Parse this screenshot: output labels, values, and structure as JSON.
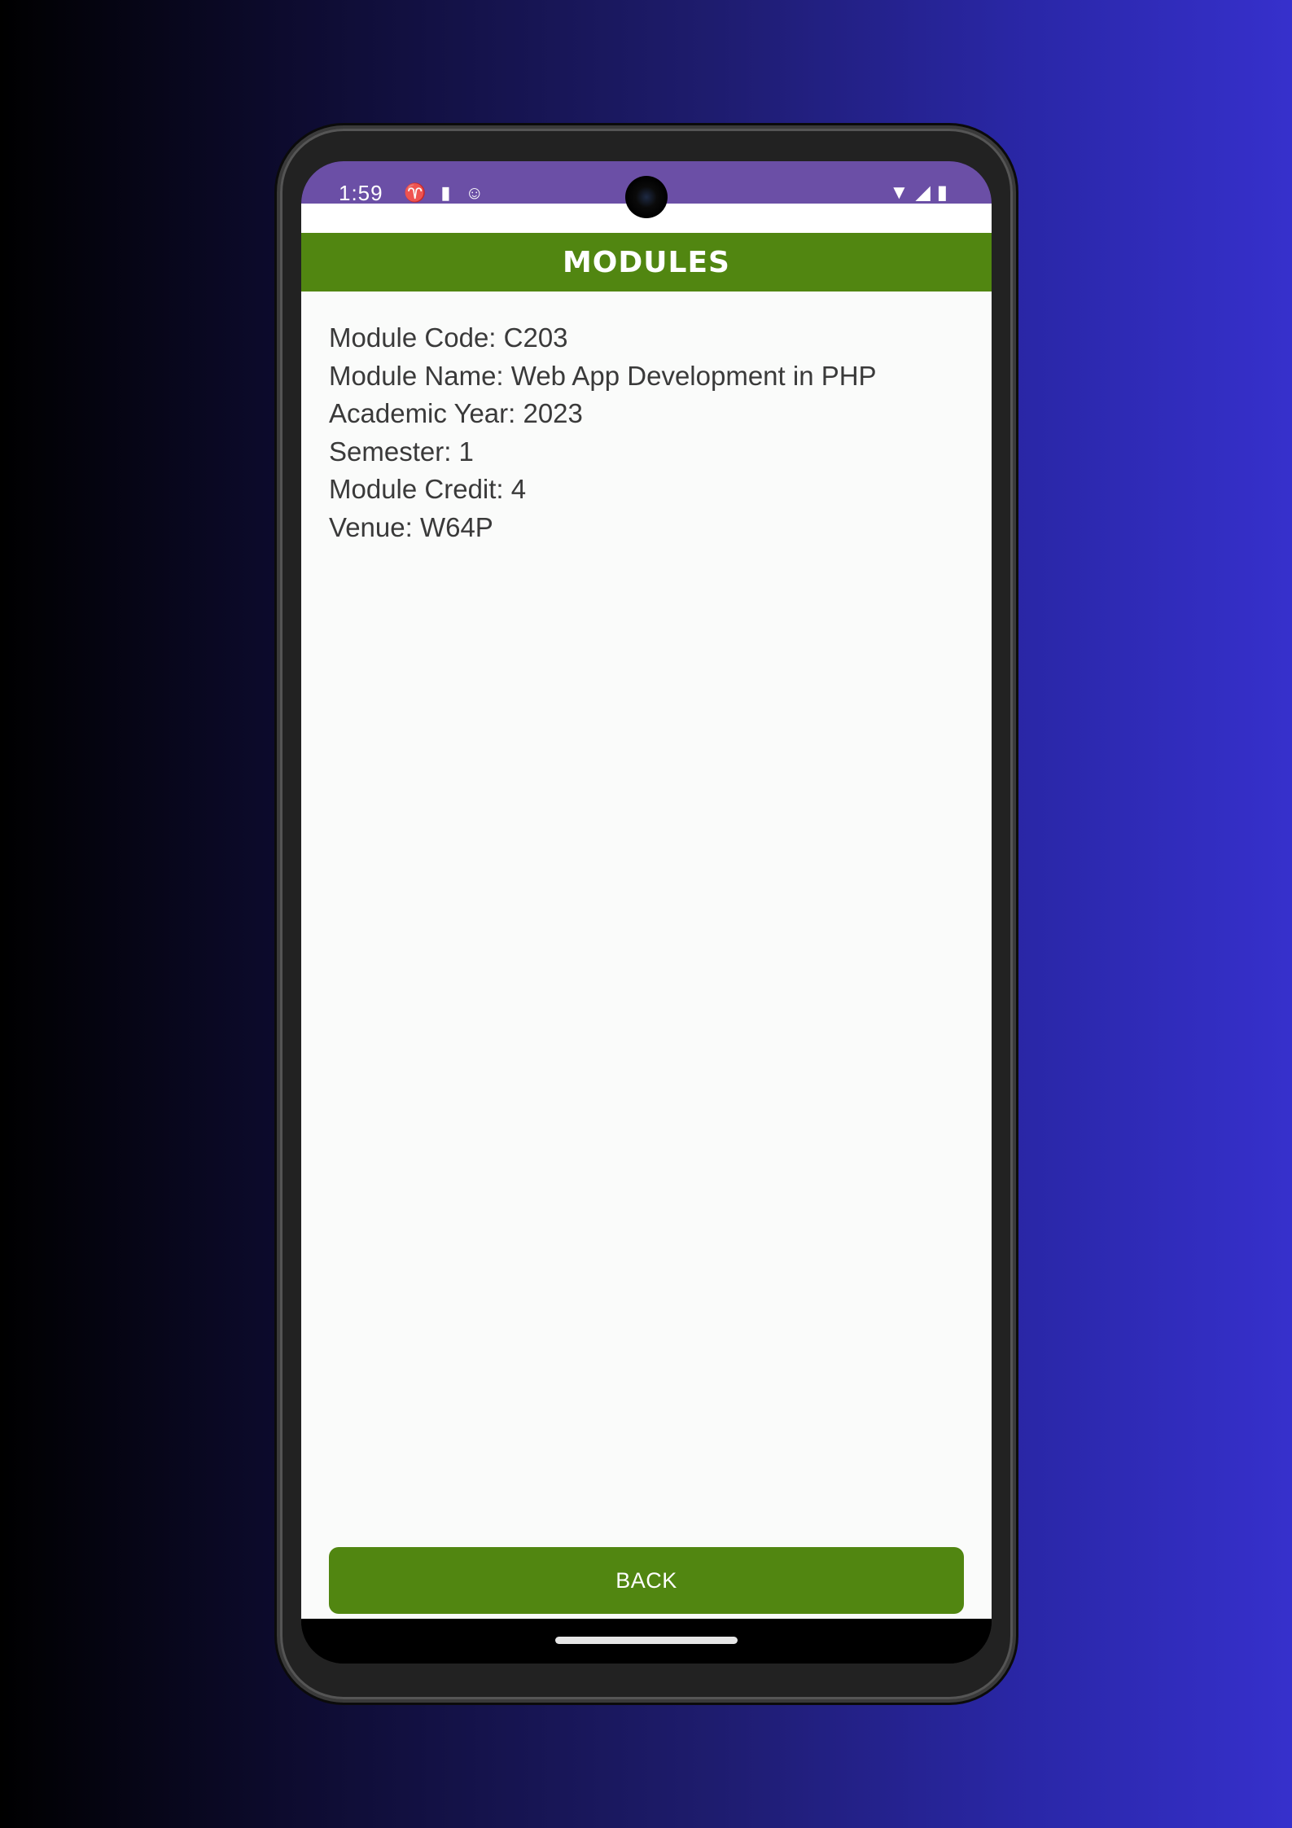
{
  "status_bar": {
    "time": "1:59",
    "left_icons": [
      "accessibility-icon",
      "sd-card-icon",
      "android-face-icon"
    ],
    "right_icons": [
      "wifi-icon",
      "signal-icon",
      "battery-icon"
    ],
    "color": "#6b4fa6"
  },
  "app_bar": {
    "title": "MODULES",
    "color": "#518611"
  },
  "module": {
    "code": "Module Code: C203",
    "name": "Module Name: Web App Development in PHP",
    "academic_year": "Academic Year: 2023",
    "semester": "Semester: 1",
    "credit": "Module Credit: 4",
    "venue": "Venue: W64P"
  },
  "actions": {
    "back_label": "BACK"
  }
}
